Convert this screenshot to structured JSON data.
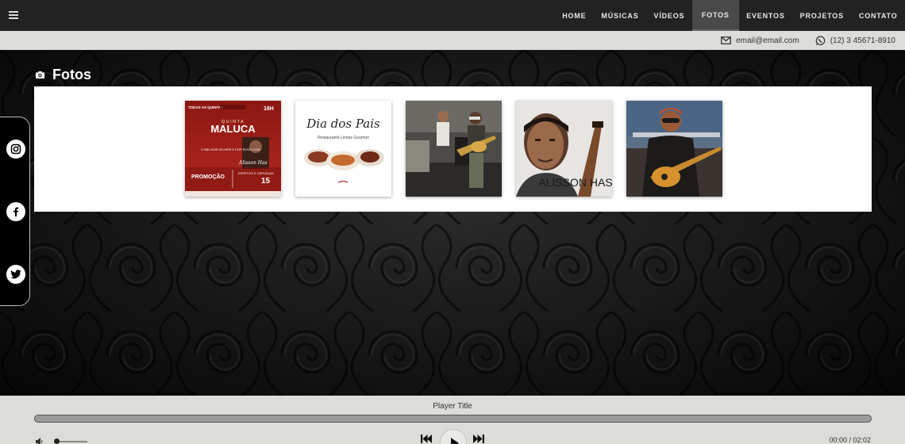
{
  "nav": {
    "items": [
      "HOME",
      "MÚSICAS",
      "VÍDEOS",
      "FOTOS",
      "EVENTOS",
      "PROJETOS",
      "CONTATO"
    ],
    "active": "FOTOS"
  },
  "contact": {
    "email": "email@email.com",
    "phone": "(12) 3 45671-8910"
  },
  "social": [
    "instagram-icon",
    "facebook-icon",
    "twitter-icon"
  ],
  "section": {
    "title": "Fotos",
    "icon": "camera-icon"
  },
  "photos": [
    {
      "id": "poster-quinta-maluca",
      "lines": [
        "TODAS AS QUINTAS",
        "18H",
        "QUINTA",
        "MALUCA",
        "O MELHOR DO MPB E POP ROCK COM",
        "Alisson Has",
        "PROMOÇÃO",
        "ESPETOS E CERVEJAS",
        "15"
      ]
    },
    {
      "id": "dia-dos-pais",
      "lines": [
        "Dia dos Pais",
        "Restaurante Lemos Gourmet"
      ]
    },
    {
      "id": "band-photo",
      "lines": []
    },
    {
      "id": "portrait",
      "lines": [
        "ALISSON HAS"
      ]
    },
    {
      "id": "guitar-photo",
      "lines": []
    }
  ],
  "player": {
    "title": "Player Title",
    "time": "00:00 / 02:02",
    "progress": 0,
    "volume": 0.05
  },
  "colors": {
    "navbar": "#222222",
    "contactbar": "#dcdcd8",
    "poster_red": "#a8231c"
  }
}
